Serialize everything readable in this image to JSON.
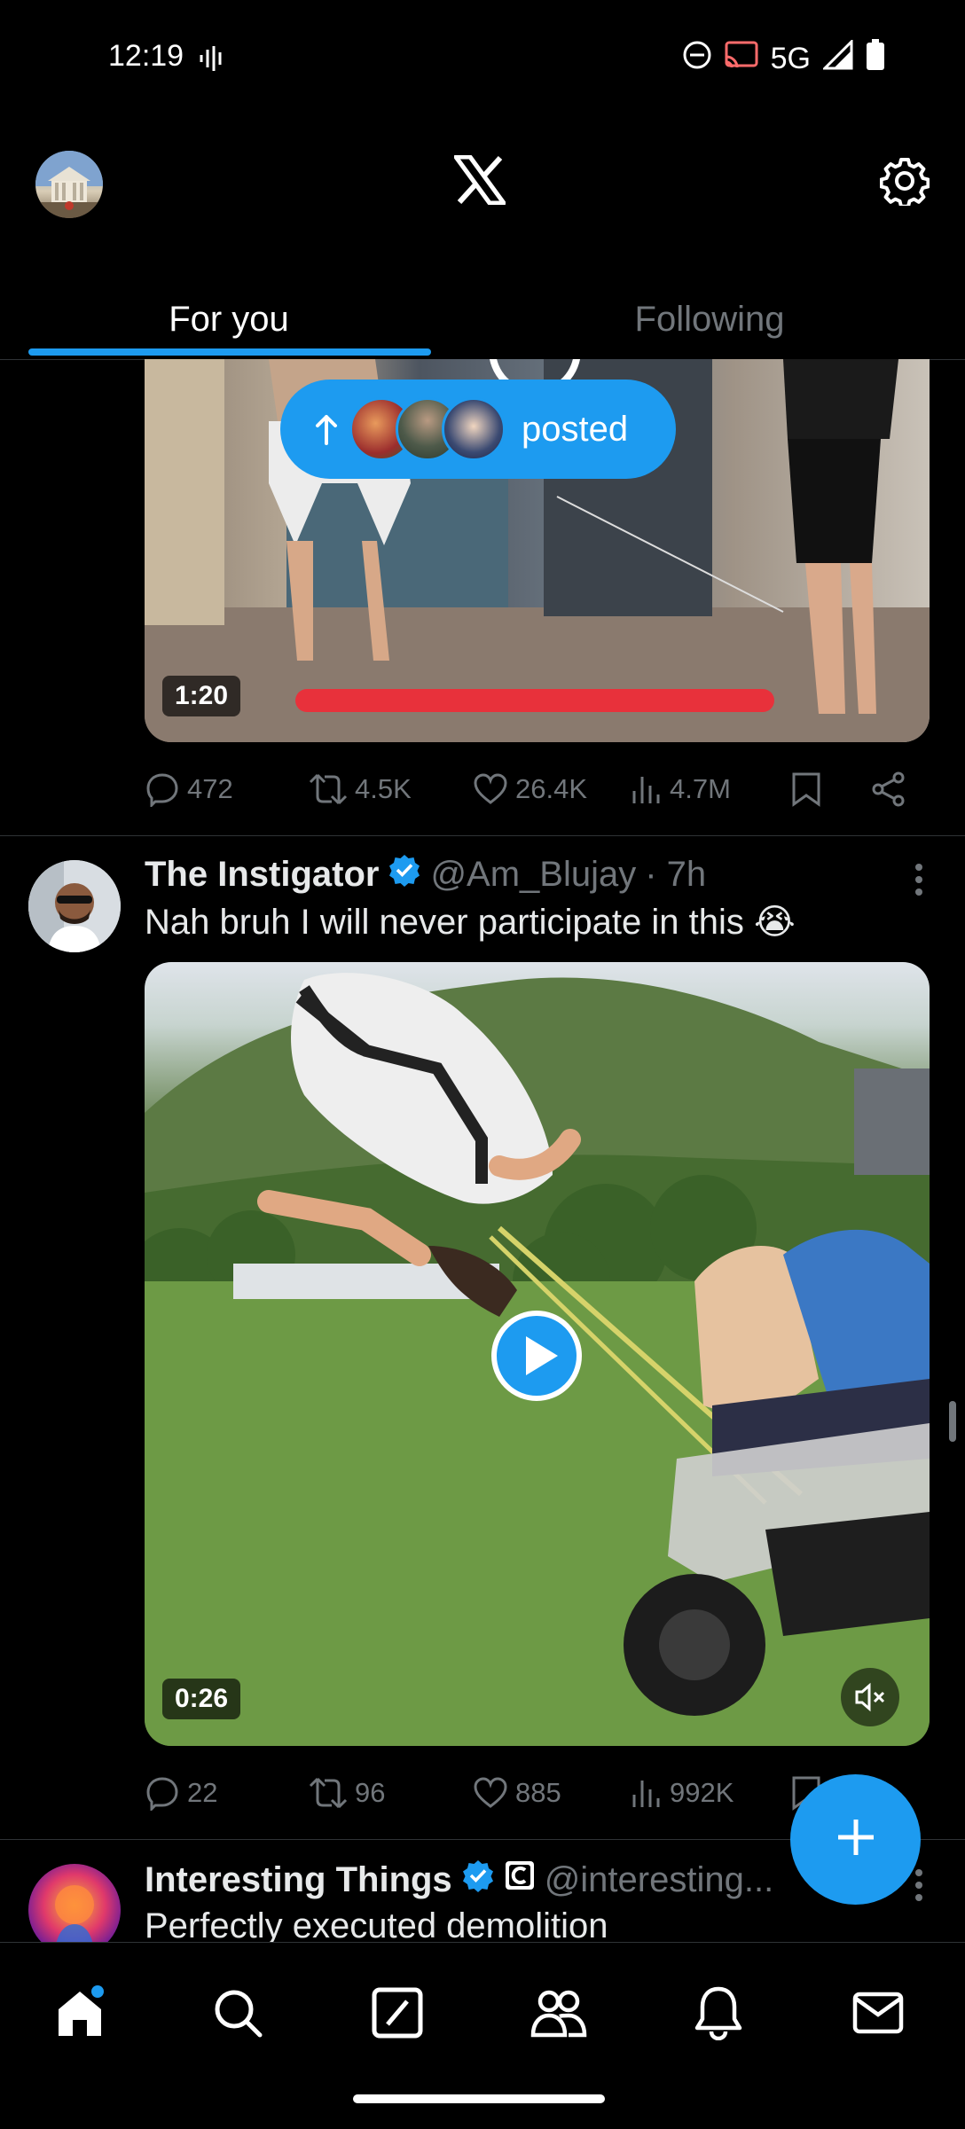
{
  "status_bar": {
    "time": "12:19",
    "network": "5G",
    "icons": [
      "sound-wave-icon",
      "do-not-disturb-icon",
      "cast-icon",
      "signal-icon",
      "battery-icon"
    ]
  },
  "header": {
    "logo": "X",
    "tabs": [
      {
        "label": "For you",
        "active": true
      },
      {
        "label": "Following",
        "active": false
      }
    ]
  },
  "new_posts_pill": {
    "label": "posted",
    "icon": "arrow-up-icon"
  },
  "feed": [
    {
      "media": {
        "duration": "1:20",
        "type": "video"
      },
      "stats": {
        "replies": "472",
        "reposts": "4.5K",
        "likes": "26.4K",
        "views": "4.7M"
      }
    },
    {
      "author_name": "The Instigator",
      "verified": true,
      "handle": "@Am_Blujay",
      "time": "· 7h",
      "text": "Nah bruh I will never participate in this 😭",
      "media": {
        "duration": "0:26",
        "type": "video"
      },
      "stats": {
        "replies": "22",
        "reposts": "96",
        "likes": "885",
        "views": "992K"
      }
    },
    {
      "author_name": "Interesting Things",
      "verified": true,
      "handle": "@interesting...",
      "text": "Perfectly executed demolition"
    }
  ],
  "bottom_nav": [
    {
      "name": "home",
      "active": true,
      "has_badge": true
    },
    {
      "name": "search"
    },
    {
      "name": "grok"
    },
    {
      "name": "communities"
    },
    {
      "name": "notifications"
    },
    {
      "name": "messages"
    }
  ],
  "colors": {
    "accent": "#1d9bf0",
    "background": "#000000",
    "muted_text": "#71767b",
    "divider": "#2f3336"
  }
}
